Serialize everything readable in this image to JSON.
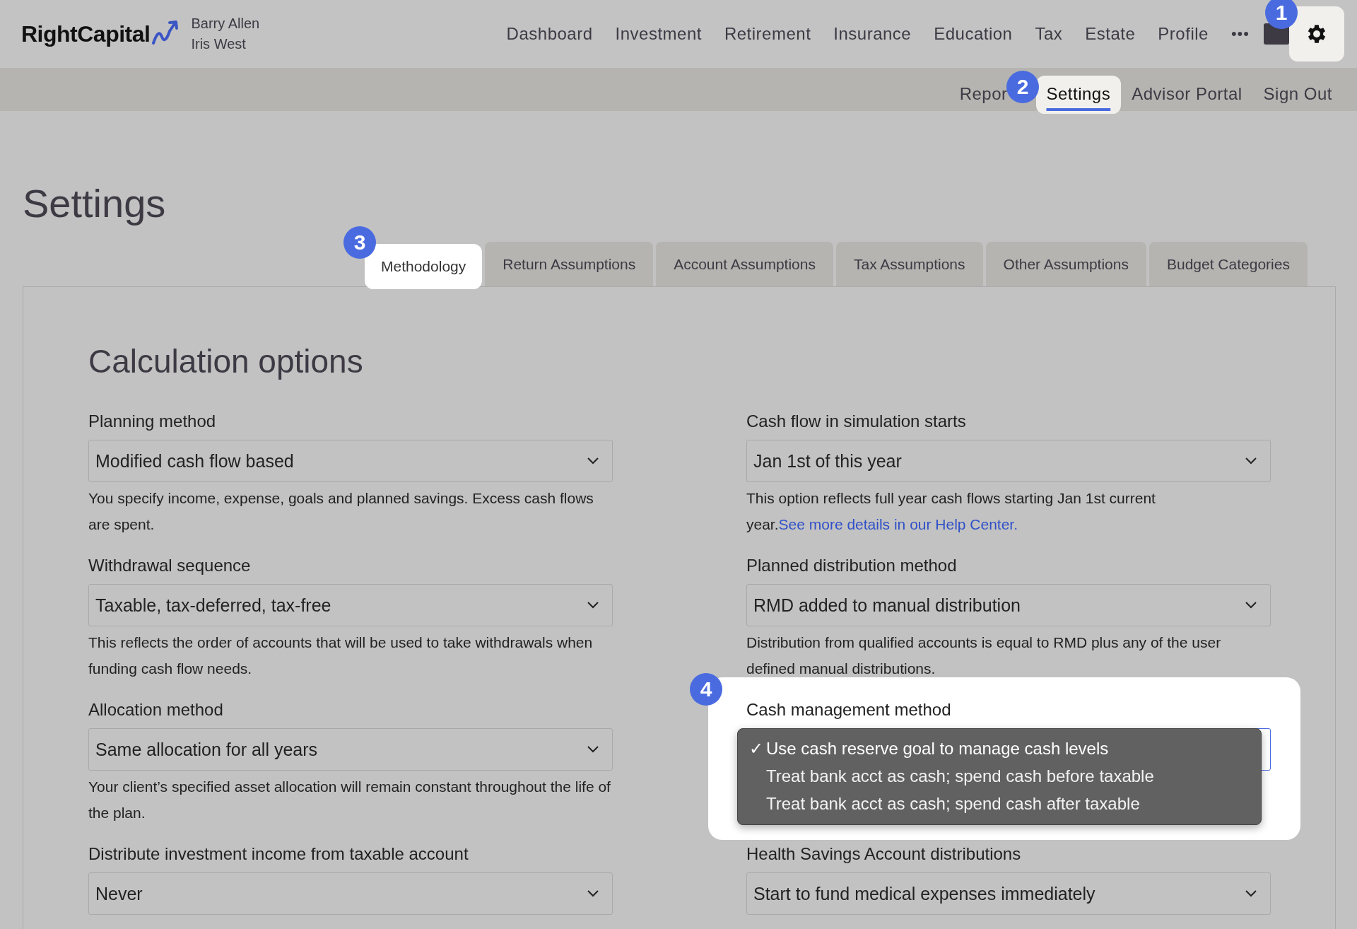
{
  "header": {
    "logo": "RightCapital",
    "clients": [
      "Barry Allen",
      "Iris West"
    ],
    "nav": [
      "Dashboard",
      "Investment",
      "Retirement",
      "Insurance",
      "Education",
      "Tax",
      "Estate",
      "Profile"
    ],
    "more": "•••",
    "settings_spotlight": true
  },
  "subnav": [
    {
      "label": "Repor",
      "selected": false
    },
    {
      "label": "Settings",
      "selected": true
    },
    {
      "label": "Advisor Portal",
      "selected": false
    },
    {
      "label": "Sign Out",
      "selected": false
    }
  ],
  "title": "Settings",
  "tabs": [
    {
      "label": "Methodology",
      "selected": true
    },
    {
      "label": "Return Assumptions",
      "selected": false
    },
    {
      "label": "Account Assumptions",
      "selected": false
    },
    {
      "label": "Tax Assumptions",
      "selected": false
    },
    {
      "label": "Other Assumptions",
      "selected": false
    },
    {
      "label": "Budget Categories",
      "selected": false
    }
  ],
  "section_title": "Calculation options",
  "fields": [
    {
      "label": "Planning method",
      "value": "Modified cash flow based",
      "help": "You specify income, expense, goals and planned savings. Excess cash flows are spent."
    },
    {
      "label": "Cash flow in simulation starts",
      "value": "Jan 1st of this year",
      "help": "This option reflects full year cash flows starting Jan 1st current year.",
      "link": "See more details in our Help Center."
    },
    {
      "label": "Withdrawal sequence",
      "value": "Taxable, tax-deferred, tax-free",
      "help": "This reflects the order of accounts that will be used to take withdrawals when funding cash flow needs."
    },
    {
      "label": "Planned distribution method",
      "value": "RMD added to manual distribution",
      "help": "Distribution from qualified accounts is equal to RMD plus any of the user defined manual distributions."
    },
    {
      "label": "Allocation method",
      "value": "Same allocation for all years",
      "help": "Your client’s specified asset allocation will remain constant throughout the life of the plan."
    },
    {
      "label": "Cash management method",
      "spotlight": true,
      "check": "✓",
      "options": [
        {
          "label": "Use cash reserve goal to manage cash levels",
          "selected": true
        },
        {
          "label": "Treat bank acct as cash; spend cash before taxable",
          "selected": false
        },
        {
          "label": "Treat bank acct as cash; spend cash after taxable",
          "selected": false
        }
      ]
    },
    {
      "label": "Distribute investment income from taxable account",
      "value": "Never"
    },
    {
      "label": "Health Savings Account distributions",
      "value": "Start to fund medical expenses immediately"
    }
  ],
  "steps": [
    "1",
    "2",
    "3",
    "4"
  ]
}
